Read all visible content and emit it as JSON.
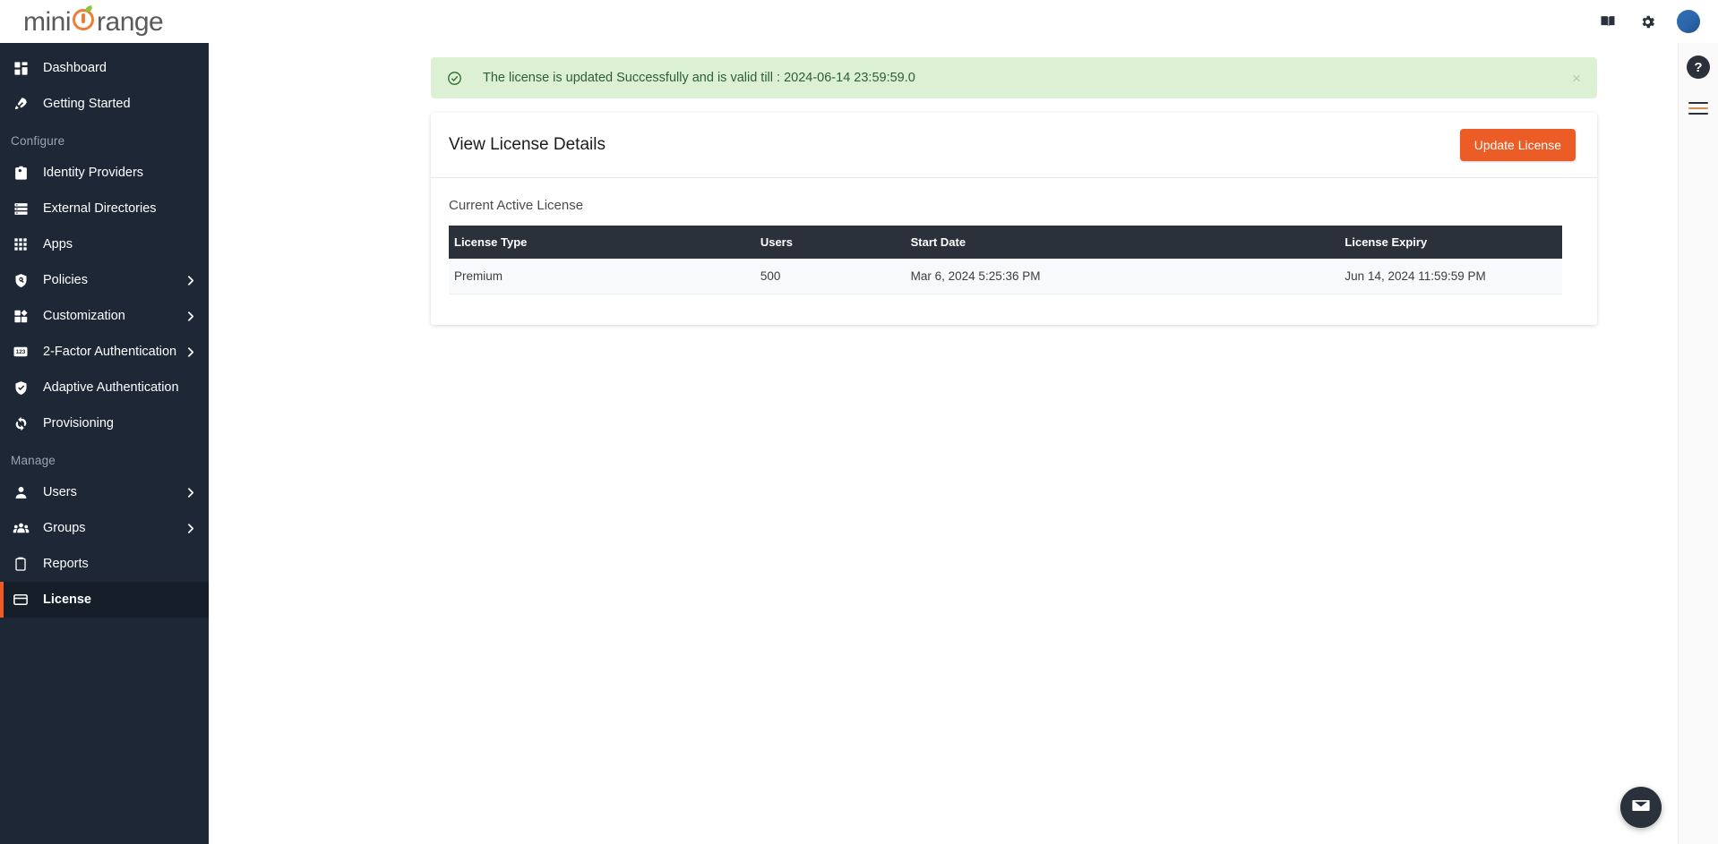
{
  "brand": {
    "logo_first": "mini",
    "logo_last": "range",
    "accent_color": "#ec5c26",
    "leaf_color": "#8cc63f"
  },
  "topbar": {
    "icons": [
      {
        "name": "documentation-book-icon",
        "label": "Documentation"
      },
      {
        "name": "settings-gear-icon",
        "label": "Settings"
      }
    ],
    "avatar_label": "Account"
  },
  "sidebar": {
    "items": [
      {
        "label": "Dashboard",
        "icon": "dashboard-icon",
        "chevron": false,
        "active": false,
        "type": "item"
      },
      {
        "label": "Getting Started",
        "icon": "rocket-icon",
        "chevron": false,
        "active": false,
        "type": "item"
      },
      {
        "label": "Configure",
        "type": "section"
      },
      {
        "label": "Identity Providers",
        "icon": "id-badge-icon",
        "chevron": false,
        "active": false,
        "type": "item"
      },
      {
        "label": "External Directories",
        "icon": "server-list-icon",
        "chevron": false,
        "active": false,
        "type": "item"
      },
      {
        "label": "Apps",
        "icon": "grid-apps-icon",
        "chevron": false,
        "active": false,
        "type": "item"
      },
      {
        "label": "Policies",
        "icon": "shield-search-icon",
        "chevron": true,
        "active": false,
        "type": "item"
      },
      {
        "label": "Customization",
        "icon": "customization-blocks-icon",
        "chevron": true,
        "active": false,
        "type": "item"
      },
      {
        "label": "2-Factor Authentication",
        "icon": "numeric-keypad-icon",
        "chevron": true,
        "active": false,
        "type": "item"
      },
      {
        "label": "Adaptive Authentication",
        "icon": "shield-check-icon",
        "chevron": false,
        "active": false,
        "type": "item"
      },
      {
        "label": "Provisioning",
        "icon": "sync-arrows-icon",
        "chevron": false,
        "active": false,
        "type": "item"
      },
      {
        "label": "Manage",
        "type": "section"
      },
      {
        "label": "Users",
        "icon": "user-icon",
        "chevron": true,
        "active": false,
        "type": "item"
      },
      {
        "label": "Groups",
        "icon": "users-group-icon",
        "chevron": true,
        "active": false,
        "type": "item"
      },
      {
        "label": "Reports",
        "icon": "clipboard-icon",
        "chevron": false,
        "active": false,
        "type": "item"
      },
      {
        "label": "License",
        "icon": "credit-card-icon",
        "chevron": false,
        "active": true,
        "type": "item"
      }
    ]
  },
  "alert": {
    "type": "success",
    "icon": "check-circle-icon",
    "message": "The license is updated Successfully and is valid till : 2024-06-14 23:59:59.0",
    "close_label": "×",
    "background_color": "#dcf0d4",
    "text_color": "#2e5e33"
  },
  "page": {
    "title": "View License Details",
    "primary_button": "Update License",
    "section_label": "Current Active License"
  },
  "table": {
    "columns": [
      "License Type",
      "Users",
      "Start Date",
      "License Expiry"
    ],
    "rows": [
      {
        "license_type": "Premium",
        "users": "500",
        "start_date": "Mar 6, 2024 5:25:36 PM",
        "license_expiry": "Jun 14, 2024 11:59:59 PM"
      }
    ]
  },
  "rail": {
    "help_label": "?",
    "menu_name": "hamburger-menu-icon"
  },
  "chat": {
    "name": "email-chat-icon",
    "label": "Contact support"
  }
}
